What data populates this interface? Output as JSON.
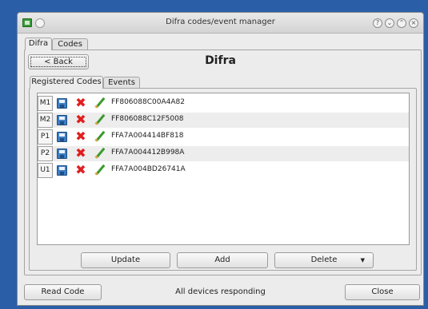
{
  "window": {
    "title": "Difra codes/event manager",
    "title_buttons": [
      "?",
      "⌄",
      "⌃",
      "×"
    ]
  },
  "outer_tabs": [
    {
      "label": "Difra",
      "active": true
    },
    {
      "label": "Codes",
      "active": false
    }
  ],
  "header": {
    "back_label": "< Back",
    "page_title": "Difra"
  },
  "inner_tabs": [
    {
      "label": "Registered Codes",
      "active": true
    },
    {
      "label": "Events",
      "active": false
    }
  ],
  "codes": [
    {
      "slot": "M1",
      "code": "FF806088C00A4A82"
    },
    {
      "slot": "M2",
      "code": "FF806088C12F5008"
    },
    {
      "slot": "P1",
      "code": "FFA7A004414BF818"
    },
    {
      "slot": "P2",
      "code": "FFA7A004412B998A"
    },
    {
      "slot": "U1",
      "code": "FFA7A004BD26741A"
    }
  ],
  "actions": {
    "update_label": "Update",
    "add_label": "Add",
    "delete_label": "Delete"
  },
  "footer": {
    "read_code_label": "Read Code",
    "status_text": "All devices responding",
    "close_label": "Close"
  }
}
